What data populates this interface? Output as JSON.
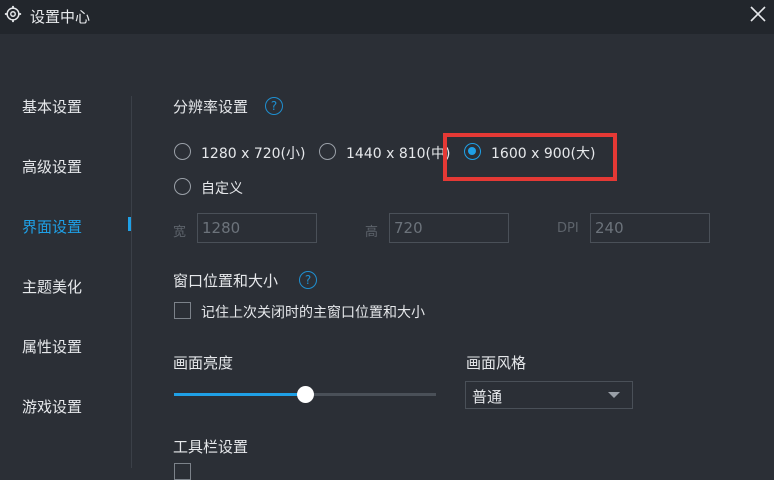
{
  "window": {
    "title": "设置中心"
  },
  "sidebar": {
    "items": [
      {
        "label": "基本设置"
      },
      {
        "label": "高级设置"
      },
      {
        "label": "界面设置"
      },
      {
        "label": "主题美化"
      },
      {
        "label": "属性设置"
      },
      {
        "label": "游戏设置"
      }
    ],
    "active_index": 2
  },
  "resolution": {
    "title": "分辨率设置",
    "options": [
      {
        "label": "1280 x 720(小)"
      },
      {
        "label": "1440 x 810(中)"
      },
      {
        "label": "1600 x 900(大)"
      },
      {
        "label": "自定义"
      }
    ],
    "selected": "1600 x 900(大)",
    "fields": [
      {
        "label": "宽",
        "value": "1280"
      },
      {
        "label": "高",
        "value": "720"
      },
      {
        "label": "DPI",
        "value": "240"
      }
    ]
  },
  "window_pos": {
    "title": "窗口位置和大小",
    "remember_label": "记住上次关闭时的主窗口位置和大小"
  },
  "brightness": {
    "title": "画面亮度",
    "level": 0.5
  },
  "style": {
    "title": "画面风格",
    "value": "普通"
  },
  "toolbar": {
    "title": "工具栏设置"
  },
  "colors": {
    "accent": "#1fa0e6",
    "highlight": "#e53935"
  }
}
